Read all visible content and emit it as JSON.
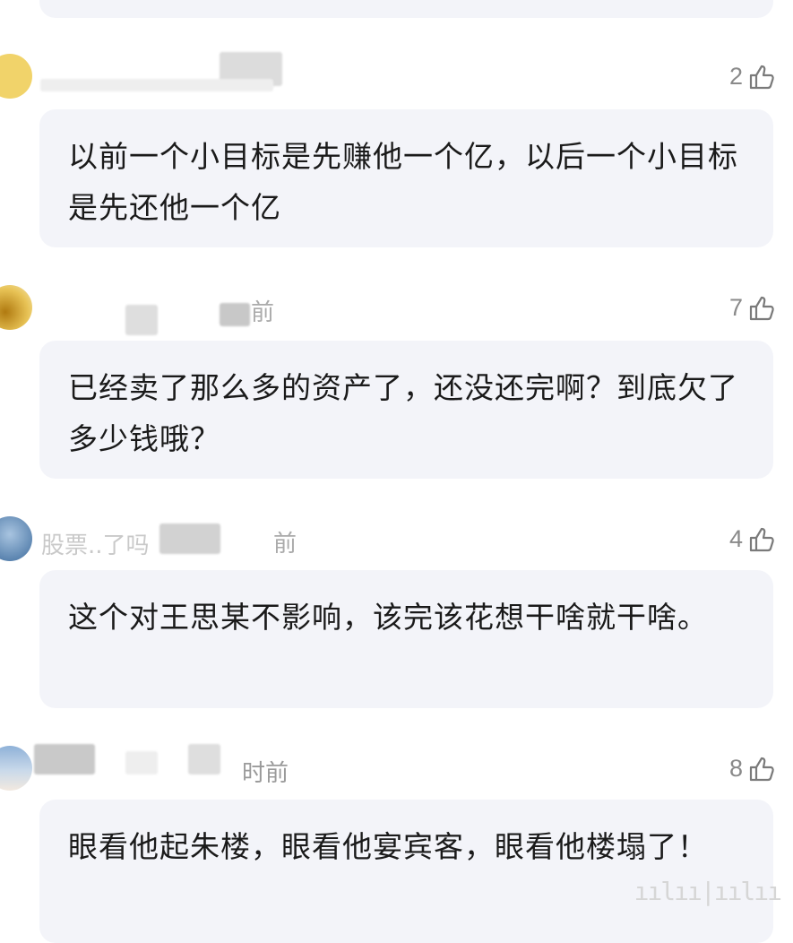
{
  "comments": [
    {
      "time": "",
      "likes": "2",
      "text": "以前一个小目标是先赚他一个亿，以后一个小目标是先还他一个亿",
      "avatar_color": "#f1d36a"
    },
    {
      "time": "前",
      "likes": "7",
      "text": "已经卖了那么多的资产了，还没还完啊？到底欠了多少钱哦？",
      "avatar_color": "#d8a83a"
    },
    {
      "username_faded": "股票..了吗",
      "time": "前",
      "likes": "4",
      "text": "这个对王思某不影响，该完该花想干啥就干啥。",
      "avatar_color": "#5b86b5"
    },
    {
      "time": "时前",
      "likes": "8",
      "text": "眼看他起朱楼，眼看他宴宾客，眼看他楼塌了！",
      "avatar_color": "#8fb1d8"
    }
  ],
  "watermark": "ıılıı|ıılıı"
}
